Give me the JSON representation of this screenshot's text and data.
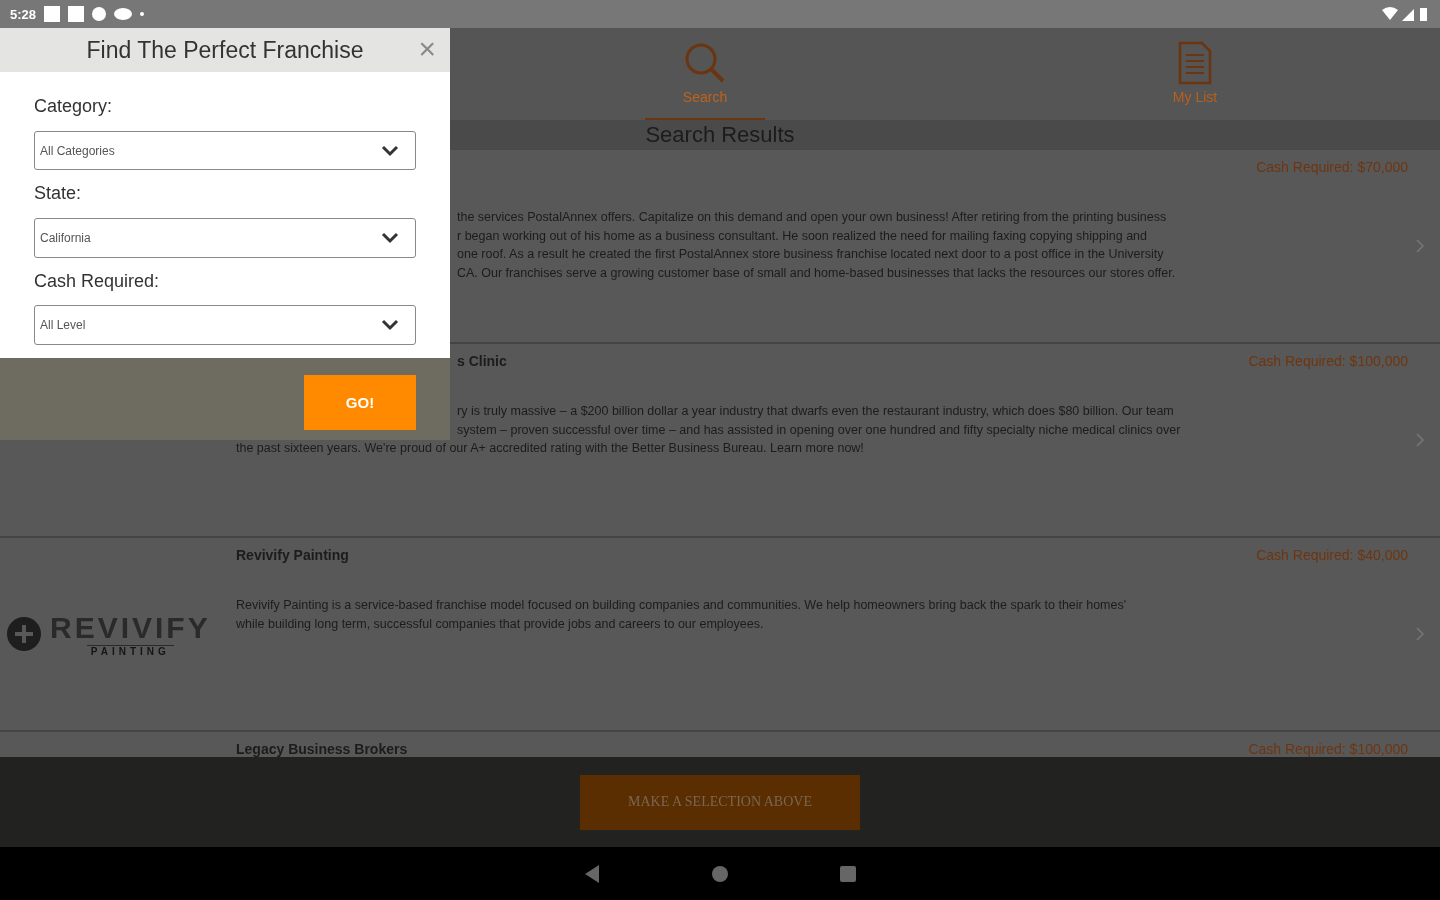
{
  "status_bar": {
    "time": "5:28"
  },
  "tabs": [
    {
      "label": "Search",
      "selected": true,
      "kind": "search"
    },
    {
      "label": "My List",
      "selected": false,
      "kind": "list"
    }
  ],
  "results_header": "Search Results",
  "results": [
    {
      "cash": "Cash Required: $70,000",
      "lines": [
        {
          "text": "the services PostalAnnex offers. Capitalize on this demand and open your own business! After retiring from the printing business",
          "kind": "partial"
        },
        {
          "text": "r began working out of his home as a business consultant. He soon realized the need for mailing faxing copying shipping and",
          "kind": "partial"
        },
        {
          "text": "one roof. As a result he created the first PostalAnnex store business franchise located next door to a post office in the University",
          "kind": "partial"
        },
        {
          "text": "CA. Our franchises serve a growing customer base of small and home-based businesses that lacks the resources our stores offer.",
          "kind": "partial"
        }
      ]
    },
    {
      "title": "s Clinic",
      "title_partial": true,
      "cash": "Cash Required: $100,000",
      "lines": [
        {
          "text": "ry is truly massive – a $200 billion dollar a year industry that dwarfs even the restaurant industry, which does $80 billion. Our team",
          "kind": "partial"
        },
        {
          "text": "system – proven successful over time – and has assisted in opening over one hundred and fifty specialty niche medical clinics over",
          "kind": "partial"
        },
        {
          "text": "the past sixteen years. We're proud of our A+ accredited rating with the Better Business Bureau. Learn more now!",
          "kind": "full"
        }
      ]
    },
    {
      "title": "Revivify Painting",
      "cash": "Cash Required: $40,000",
      "logo": "REVIVIFY",
      "logo_sub": "PAINTING",
      "lines": [
        {
          "text": "Revivify Painting is a service-based franchise model focused on building companies and communities. We help homeowners bring back the spark to their homes'",
          "kind": "full"
        },
        {
          "text": "while building long term, successful companies that provide jobs and careers to our employees.",
          "kind": "full"
        }
      ]
    },
    {
      "title": "Legacy Business Brokers",
      "cash": "Cash Required: $100,000"
    }
  ],
  "bottom_button": "MAKE A SELECTION ABOVE",
  "dialog": {
    "title": "Find The Perfect Franchise",
    "close": "×",
    "fields": [
      {
        "label": "Category:",
        "value": "All Categories"
      },
      {
        "label": "State:",
        "value": "California"
      },
      {
        "label": "Cash Required:",
        "value": "All Level"
      }
    ],
    "submit": "GO!"
  }
}
